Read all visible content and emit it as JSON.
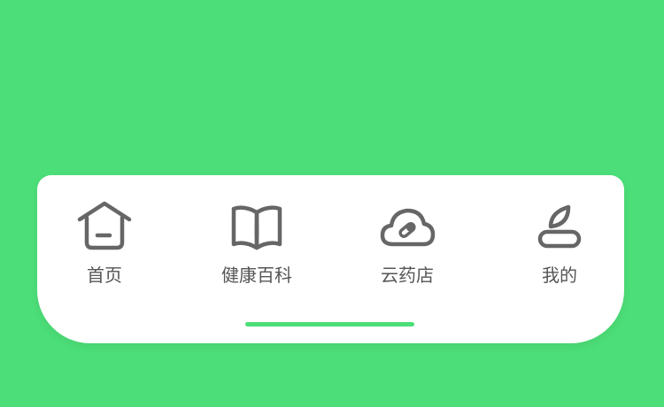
{
  "colors": {
    "background": "#4cde78",
    "card": "#ffffff",
    "icon_stroke": "#666666",
    "label_text": "#555555",
    "indicator": "#4cde78"
  },
  "tabbar": {
    "tabs": [
      {
        "label": "首页",
        "icon": "home-icon"
      },
      {
        "label": "健康百科",
        "icon": "book-icon"
      },
      {
        "label": "云药店",
        "icon": "cloud-pill-icon"
      },
      {
        "label": "我的",
        "icon": "user-leaf-icon"
      }
    ]
  }
}
